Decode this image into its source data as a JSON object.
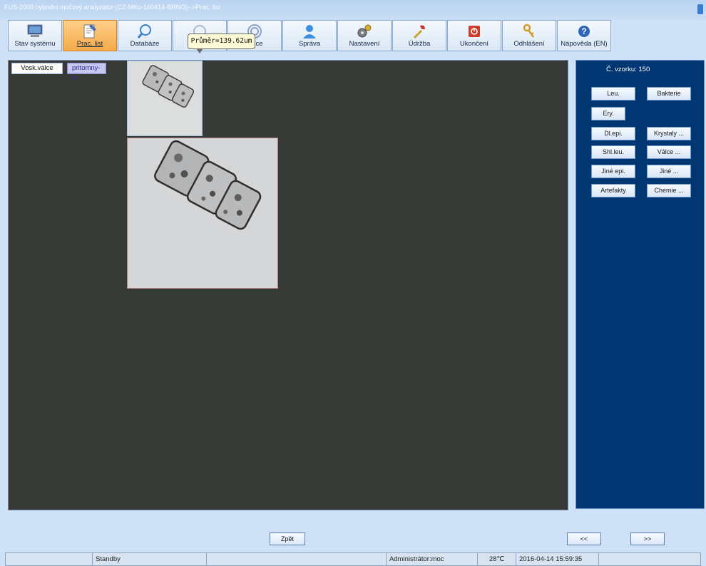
{
  "window": {
    "title": "FUS-2000 hybridní močový analyzátor (CZ-MKo-160414-BRNO)-->Prac. list"
  },
  "toolbar": {
    "buttons": [
      {
        "label": "Stav systému",
        "icon": "monitor-icon"
      },
      {
        "label": "Prac. list",
        "icon": "worksheet-icon",
        "active": true
      },
      {
        "label": "Databáze",
        "icon": "magnifier-icon"
      },
      {
        "label": "",
        "icon": "qc-icon"
      },
      {
        "label": "race",
        "icon": "calibration-target-icon"
      },
      {
        "label": "Správa",
        "icon": "user-icon"
      },
      {
        "label": "Nastavení",
        "icon": "gears-icon"
      },
      {
        "label": "Údržba",
        "icon": "tools-icon"
      },
      {
        "label": "Ukončení",
        "icon": "power-icon"
      },
      {
        "label": "Odhlášení",
        "icon": "keys-icon"
      },
      {
        "label": "Nápověda (EN)",
        "icon": "help-icon"
      }
    ]
  },
  "tooltip": {
    "text": "Průměr=139.62um"
  },
  "image_view": {
    "category_label": "Vosk.válce",
    "status_label": "pritomny-V"
  },
  "side_panel": {
    "sample_number": "Č. vzorku: 150",
    "buttons": [
      "Leu.",
      "Bakterie",
      "Ery.",
      "Dl.epi.",
      "Krystaly ...",
      "Shl.leu.",
      "Válce ...",
      "Jiné epi.",
      "Jiné ...",
      "Artefakty",
      "Chemie ..."
    ]
  },
  "nav": {
    "back": "Zpět",
    "prev": "<<",
    "next": ">>"
  },
  "statusbar": {
    "state": "Standby",
    "user": "Administrátor:moc",
    "temperature": "28℃",
    "datetime": "2016-04-14 15:59:35"
  },
  "colors": {
    "active_tab": "#f4a948",
    "side_panel": "#003671",
    "image_area": "#373936"
  }
}
